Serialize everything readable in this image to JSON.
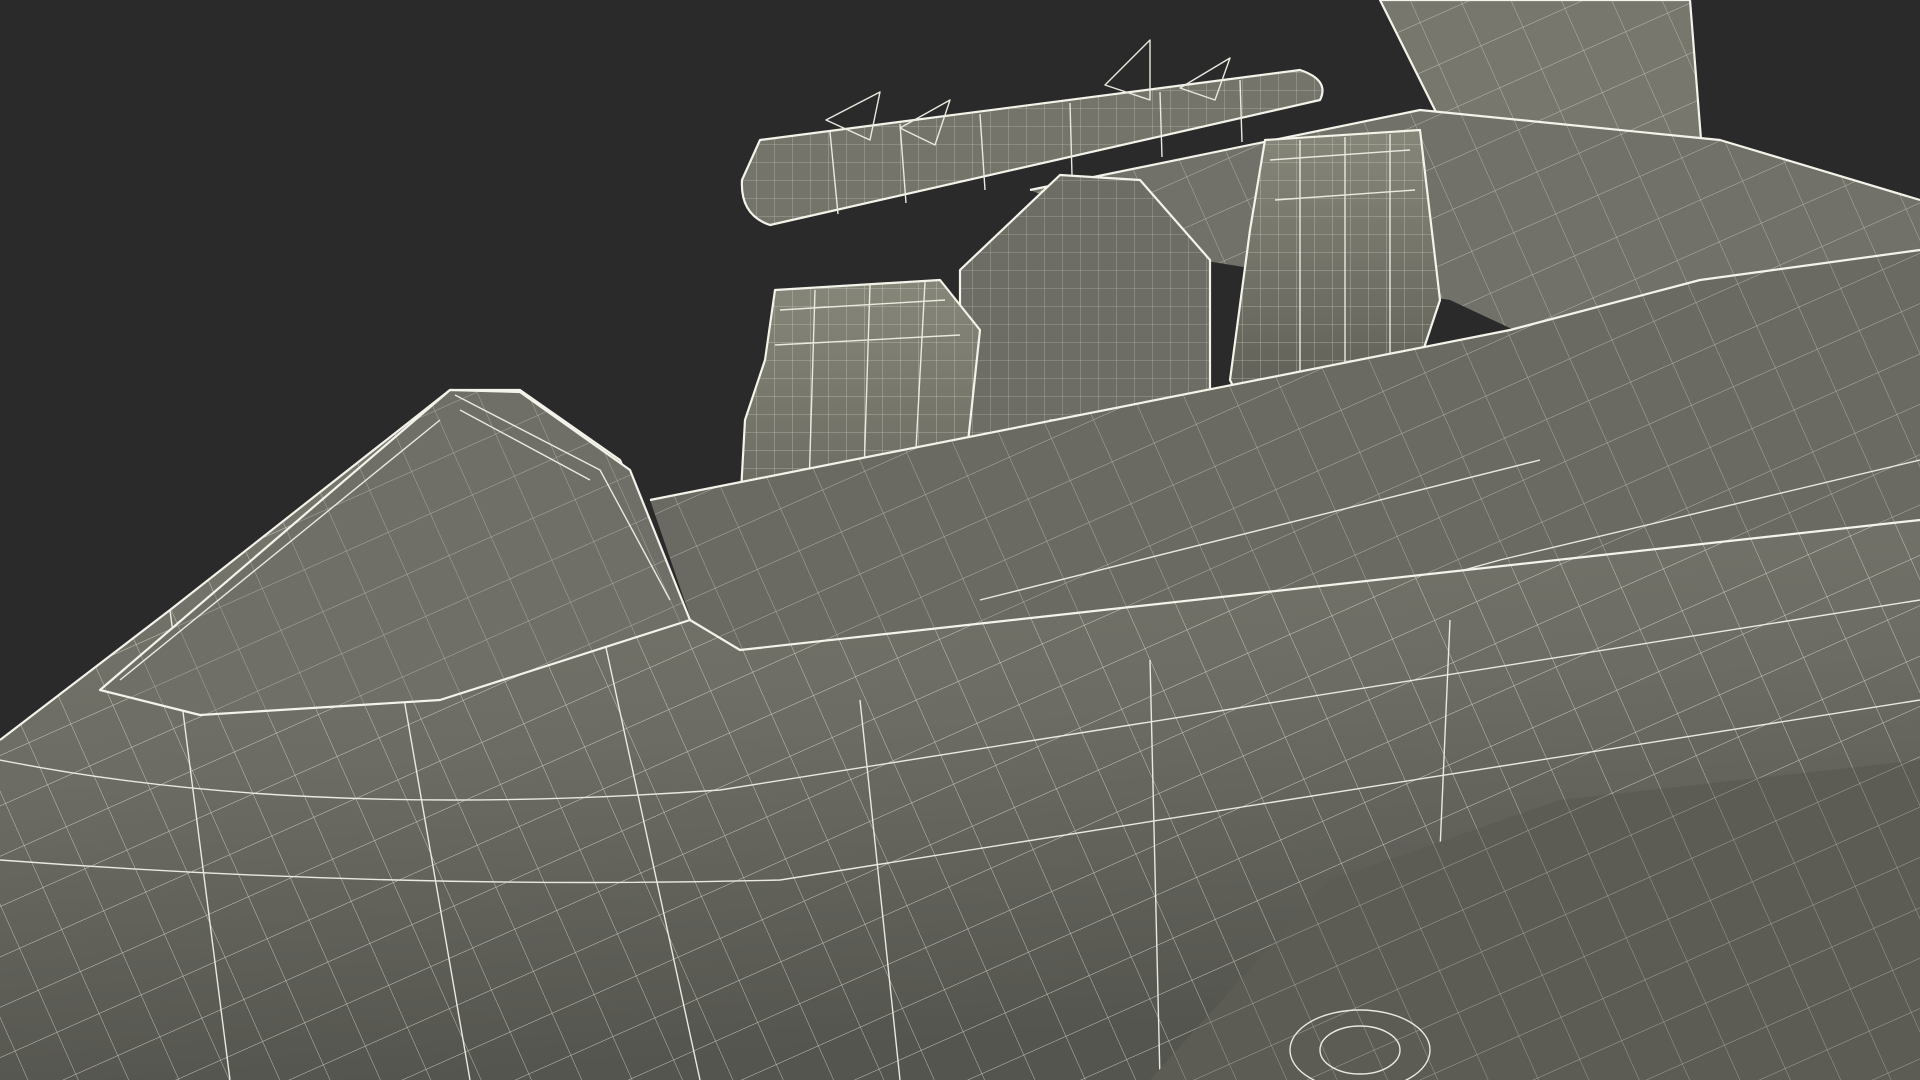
{
  "scene": {
    "subject": "wireframe-render",
    "colors": {
      "background": "#2a2a2a",
      "surface": "#6e6e66",
      "surface_dark": "#55554f",
      "surface_light": "#83837a",
      "wire": "#e9e9df"
    }
  }
}
